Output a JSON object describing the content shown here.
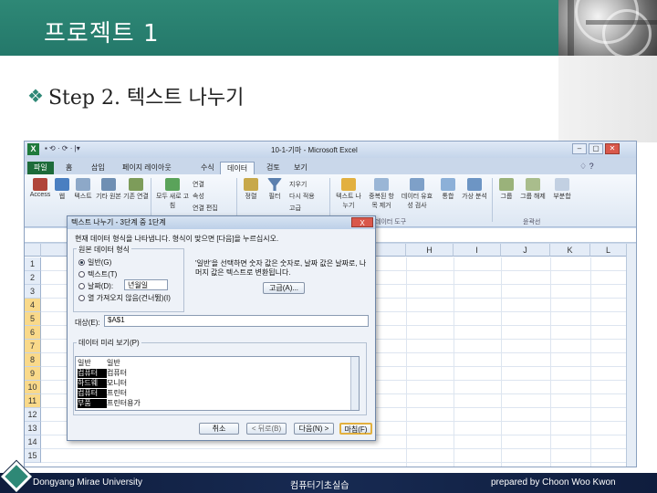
{
  "slide": {
    "title": "프로젝트 1",
    "step_text": "Step 2. 텍스트 나누기",
    "footer_left": "Dongyang Mirae University",
    "footer_center": "컴퓨터기초실습",
    "footer_right": "prepared by Choon Woo Kwon"
  },
  "excel": {
    "window_title": "10-1-기마 - Microsoft Excel",
    "app_icon": "X",
    "quick_access": "▪ ⟲ · ⟳ · |▾",
    "tabs": [
      "파일",
      "홈",
      "삽입",
      "페이지 레이아웃",
      "수식",
      "데이터",
      "검토",
      "보기"
    ],
    "active_tab": "데이터",
    "ribbon_items": [
      "Access",
      "웹",
      "텍스트",
      "기타 원본",
      "기존 연결",
      "모두 새로 고침",
      "연결",
      "속성",
      "연결 편집",
      "정렬",
      "필터",
      "지우기",
      "다시 적용",
      "고급",
      "텍스트 나누기",
      "중복된 항목 제거",
      "데이터 유효성 검사",
      "통합",
      "가상 분석",
      "그룹",
      "그룹 해제",
      "부분합"
    ],
    "ribbon_groups": [
      "데이터 도구",
      "윤곽선"
    ],
    "column_headers": [
      "H",
      "I",
      "J",
      "K",
      "L"
    ],
    "rows": [
      "1",
      "2",
      "3",
      "4",
      "5",
      "6",
      "7",
      "8",
      "9",
      "10",
      "11",
      "12",
      "13",
      "14",
      "15"
    ],
    "selected_rows": [
      4,
      5,
      6,
      7,
      8,
      9,
      10,
      11
    ],
    "row_cells": [
      "",
      "",
      "",
      "",
      "",
      "",
      "",
      "",
      "",
      "",
      "",
      "",
      "",
      "",
      ""
    ]
  },
  "wizard": {
    "title": "텍스트 나누기 - 3단계 중 1단계",
    "close": "X",
    "intro": "현재 데이터 형식을 나타냅니다. 형식이 맞으면 [다음]을 누르십시오.",
    "section_label": "원본 데이터 형식",
    "options": [
      {
        "label": "일반(G)",
        "selected": true
      },
      {
        "label": "텍스트(T)",
        "selected": false
      },
      {
        "label": "날짜(D):",
        "selected": false
      },
      {
        "label": "열 가져오지 않음(건너뜀)(I)",
        "selected": false
      }
    ],
    "date_value": "년월일",
    "desc": "'일반'을 선택하면 숫자 값은 숫자로, 날짜 값은 날짜로, 나머지 값은 텍스트로 변환됩니다.",
    "advanced_button": "고급(A)...",
    "dest_label": "대상(E):",
    "dest_value": "$A$1",
    "preview_label": "데이터 미리 보기(P)",
    "preview_rows": [
      {
        "a": "일반",
        "b": "일반"
      },
      {
        "a": "컴퓨터",
        "b": "컴퓨터"
      },
      {
        "a": "하드웨",
        "b": "모니터"
      },
      {
        "a": "컴퓨터",
        "b": "프린터"
      },
      {
        "a": "부품",
        "b": "프린터용가"
      }
    ],
    "buttons": [
      "취소",
      "< 뒤로(B)",
      "다음(N) >",
      "마침(F)"
    ]
  },
  "colors": {
    "header": "#2e8876",
    "footer": "#0f1d3d",
    "excel_file_tab": "#1d6b3a",
    "selected_row": "#f9d98a"
  }
}
